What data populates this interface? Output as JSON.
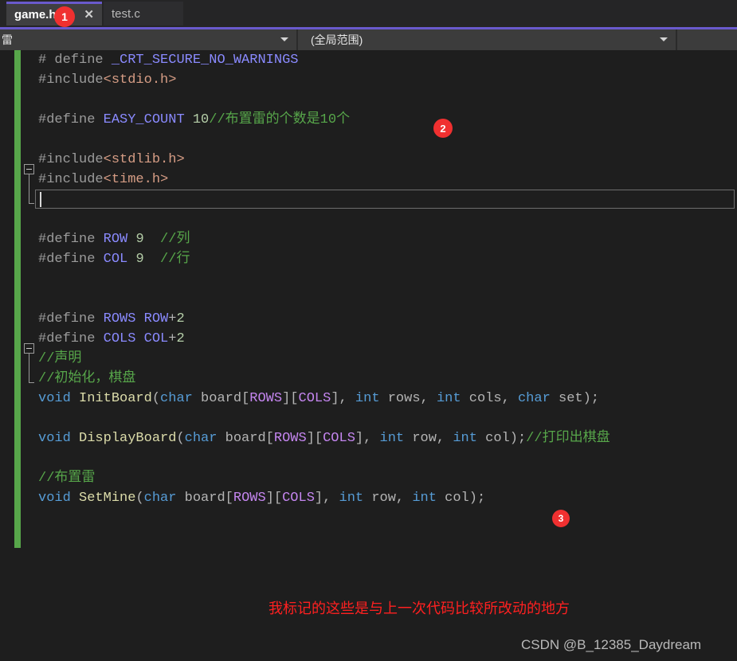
{
  "tabs": [
    {
      "label": "game.h",
      "active": true,
      "close_icon": "✕"
    },
    {
      "label": "test.c",
      "active": false
    }
  ],
  "navbar": {
    "left_combo_value": "雷",
    "scope_combo_value": "(全局范围)",
    "right_combo_value": ""
  },
  "badges": [
    {
      "label": "1"
    },
    {
      "label": "2"
    },
    {
      "label": "3"
    }
  ],
  "code_lines": [
    {
      "tokens": [
        {
          "t": "# define ",
          "c": "c-pre"
        },
        {
          "t": "_CRT_SECURE_NO_WARNINGS",
          "c": "c-macro"
        }
      ]
    },
    {
      "tokens": [
        {
          "t": "#include",
          "c": "c-pre"
        },
        {
          "t": "<stdio.h>",
          "c": "c-str"
        }
      ]
    },
    {
      "tokens": []
    },
    {
      "tokens": [
        {
          "t": "#define ",
          "c": "c-pre"
        },
        {
          "t": "EASY_COUNT",
          "c": "c-macro"
        },
        {
          "t": " ",
          "c": "c-plain"
        },
        {
          "t": "10",
          "c": "c-num"
        },
        {
          "t": "//布置雷的个数是10个",
          "c": "c-cmt"
        }
      ]
    },
    {
      "tokens": []
    },
    {
      "tokens": [
        {
          "t": "#include",
          "c": "c-pre"
        },
        {
          "t": "<stdlib.h>",
          "c": "c-str"
        }
      ]
    },
    {
      "tokens": [
        {
          "t": "#include",
          "c": "c-pre"
        },
        {
          "t": "<time.h>",
          "c": "c-str"
        }
      ]
    },
    {
      "tokens": []
    },
    {
      "tokens": []
    },
    {
      "tokens": [
        {
          "t": "#define ",
          "c": "c-pre"
        },
        {
          "t": "ROW",
          "c": "c-macro"
        },
        {
          "t": " ",
          "c": "c-plain"
        },
        {
          "t": "9",
          "c": "c-num"
        },
        {
          "t": "  ",
          "c": "c-plain"
        },
        {
          "t": "//列",
          "c": "c-cmt"
        }
      ]
    },
    {
      "tokens": [
        {
          "t": "#define ",
          "c": "c-pre"
        },
        {
          "t": "COL",
          "c": "c-macro"
        },
        {
          "t": " ",
          "c": "c-plain"
        },
        {
          "t": "9",
          "c": "c-num"
        },
        {
          "t": "  ",
          "c": "c-plain"
        },
        {
          "t": "//行",
          "c": "c-cmt"
        }
      ]
    },
    {
      "tokens": []
    },
    {
      "tokens": []
    },
    {
      "tokens": [
        {
          "t": "#define ",
          "c": "c-pre"
        },
        {
          "t": "ROWS",
          "c": "c-macro"
        },
        {
          "t": " ",
          "c": "c-plain"
        },
        {
          "t": "ROW",
          "c": "c-macro"
        },
        {
          "t": "+",
          "c": "c-punct"
        },
        {
          "t": "2",
          "c": "c-num"
        }
      ]
    },
    {
      "tokens": [
        {
          "t": "#define ",
          "c": "c-pre"
        },
        {
          "t": "COLS",
          "c": "c-macro"
        },
        {
          "t": " ",
          "c": "c-plain"
        },
        {
          "t": "COL",
          "c": "c-macro"
        },
        {
          "t": "+",
          "c": "c-punct"
        },
        {
          "t": "2",
          "c": "c-num"
        }
      ]
    },
    {
      "tokens": [
        {
          "t": "//声明",
          "c": "c-cmt"
        }
      ]
    },
    {
      "tokens": [
        {
          "t": "//初始化，棋盘",
          "c": "c-cmt"
        }
      ]
    },
    {
      "tokens": [
        {
          "t": "void",
          "c": "c-kw"
        },
        {
          "t": " ",
          "c": "c-plain"
        },
        {
          "t": "InitBoard",
          "c": "c-fn"
        },
        {
          "t": "(",
          "c": "c-punct"
        },
        {
          "t": "char",
          "c": "c-kw"
        },
        {
          "t": " board",
          "c": "c-plain"
        },
        {
          "t": "[",
          "c": "c-punct"
        },
        {
          "t": "ROWS",
          "c": "c-def"
        },
        {
          "t": "][",
          "c": "c-punct"
        },
        {
          "t": "COLS",
          "c": "c-def"
        },
        {
          "t": "], ",
          "c": "c-punct"
        },
        {
          "t": "int",
          "c": "c-kw"
        },
        {
          "t": " rows, ",
          "c": "c-plain"
        },
        {
          "t": "int",
          "c": "c-kw"
        },
        {
          "t": " cols, ",
          "c": "c-plain"
        },
        {
          "t": "char",
          "c": "c-kw"
        },
        {
          "t": " set",
          "c": "c-plain"
        },
        {
          "t": ");",
          "c": "c-punct"
        }
      ]
    },
    {
      "tokens": []
    },
    {
      "tokens": [
        {
          "t": "void",
          "c": "c-kw"
        },
        {
          "t": " ",
          "c": "c-plain"
        },
        {
          "t": "DisplayBoard",
          "c": "c-fn"
        },
        {
          "t": "(",
          "c": "c-punct"
        },
        {
          "t": "char",
          "c": "c-kw"
        },
        {
          "t": " board",
          "c": "c-plain"
        },
        {
          "t": "[",
          "c": "c-punct"
        },
        {
          "t": "ROWS",
          "c": "c-def"
        },
        {
          "t": "][",
          "c": "c-punct"
        },
        {
          "t": "COLS",
          "c": "c-def"
        },
        {
          "t": "], ",
          "c": "c-punct"
        },
        {
          "t": "int",
          "c": "c-kw"
        },
        {
          "t": " row, ",
          "c": "c-plain"
        },
        {
          "t": "int",
          "c": "c-kw"
        },
        {
          "t": " col",
          "c": "c-plain"
        },
        {
          "t": ");",
          "c": "c-punct"
        },
        {
          "t": "//打印出棋盘",
          "c": "c-cmt"
        }
      ]
    },
    {
      "tokens": []
    },
    {
      "tokens": [
        {
          "t": "//布置雷",
          "c": "c-cmt"
        }
      ]
    },
    {
      "tokens": [
        {
          "t": "void",
          "c": "c-kw"
        },
        {
          "t": " ",
          "c": "c-plain"
        },
        {
          "t": "SetMine",
          "c": "c-fn"
        },
        {
          "t": "(",
          "c": "c-punct"
        },
        {
          "t": "char",
          "c": "c-kw"
        },
        {
          "t": " board",
          "c": "c-plain"
        },
        {
          "t": "[",
          "c": "c-punct"
        },
        {
          "t": "ROWS",
          "c": "c-def"
        },
        {
          "t": "][",
          "c": "c-punct"
        },
        {
          "t": "COLS",
          "c": "c-def"
        },
        {
          "t": "], ",
          "c": "c-punct"
        },
        {
          "t": "int",
          "c": "c-kw"
        },
        {
          "t": " row, ",
          "c": "c-plain"
        },
        {
          "t": "int",
          "c": "c-kw"
        },
        {
          "t": " col",
          "c": "c-plain"
        },
        {
          "t": ");",
          "c": "c-punct"
        }
      ]
    }
  ],
  "annotations": {
    "note_red": "我标记的这些是与上一次代码比较所改动的地方",
    "watermark": "CSDN @B_12385_Daydream"
  },
  "colors": {
    "accent_purple": "#6a5acd",
    "change_bar_green": "#57a64a",
    "badge_red": "#f03030",
    "note_red": "#ff2020"
  }
}
